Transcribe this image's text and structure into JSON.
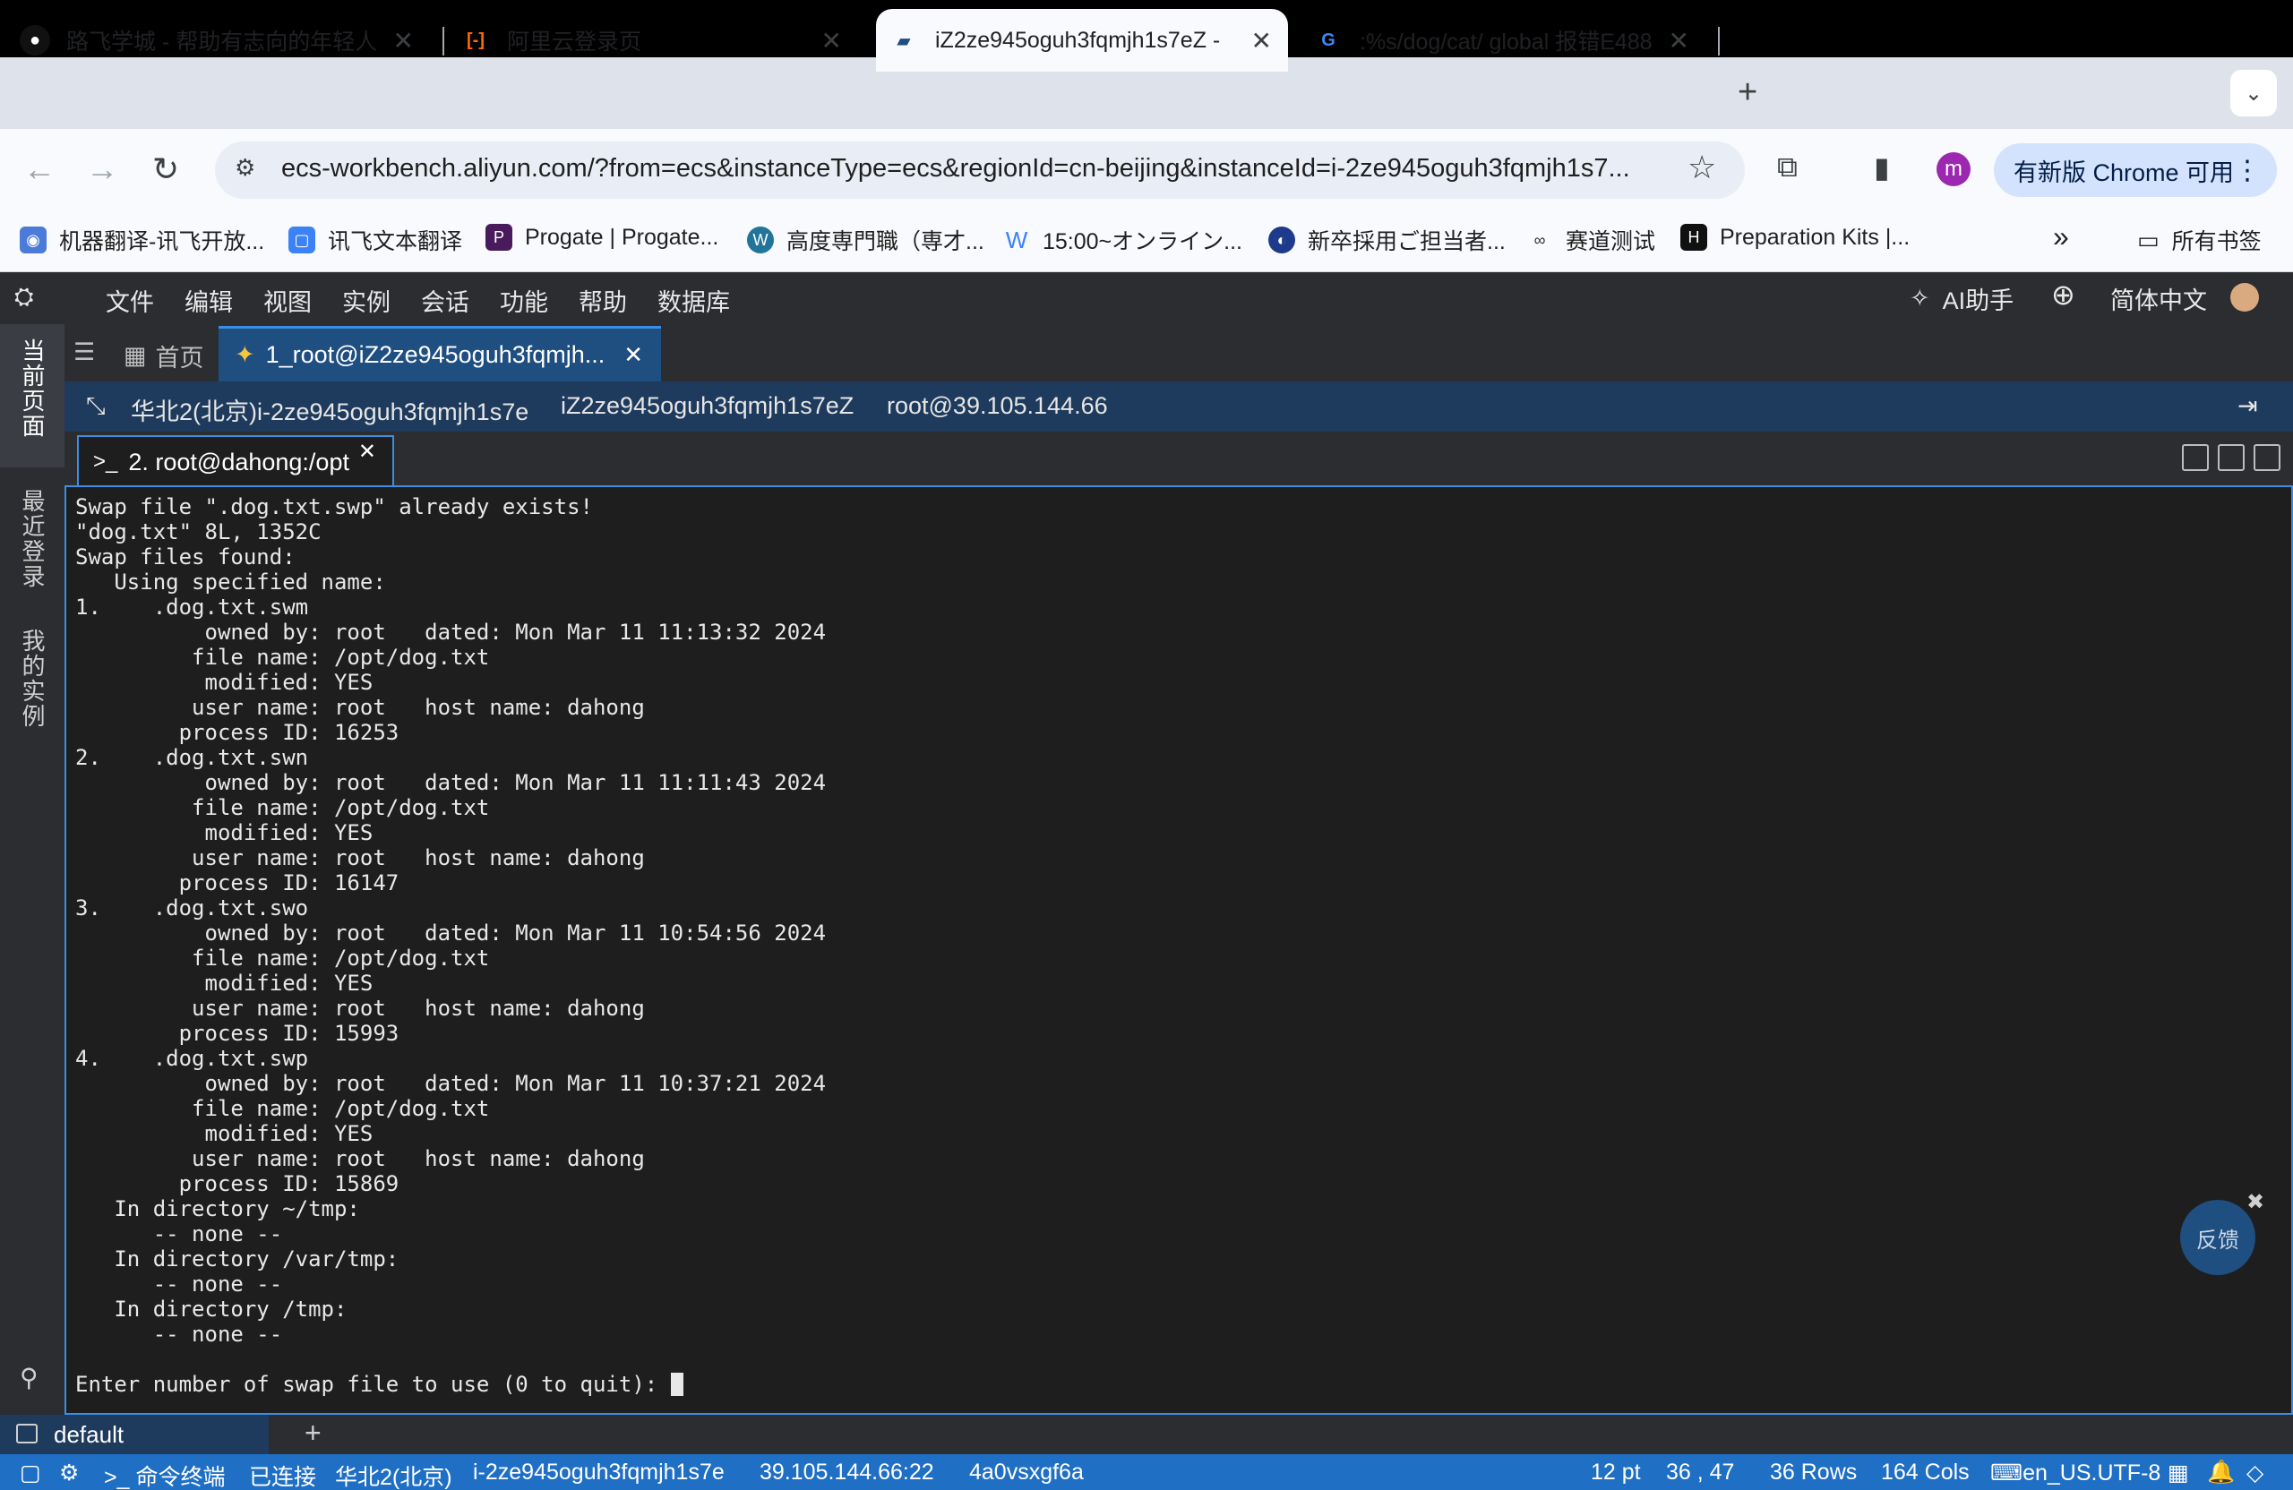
{
  "browser": {
    "tabs": [
      {
        "title": "路飞学城 - 帮助有志向的年轻人",
        "close": "✕"
      },
      {
        "title": "阿里云登录页",
        "close": "✕"
      },
      {
        "title": "iZ2ze945oguh3fqmjh1s7eZ -",
        "close": "✕"
      },
      {
        "title": ":%s/dog/cat/ global 报错E488",
        "close": "✕"
      }
    ],
    "new_tab": "+",
    "url": "ecs-workbench.aliyun.com/?from=ecs&instanceType=ecs&regionId=cn-beijing&instanceId=i-2ze945oguh3fqmjh1s7...",
    "profile_initial": "m",
    "update_button": "有新版 Chrome 可用",
    "bookmarks": [
      "机器翻译-讯飞开放...",
      "讯飞文本翻译",
      "Progate | Progate...",
      "高度専門職（専才...",
      "15:00~オンライン...",
      "新卒採用ご担当者...",
      "赛道测试",
      "Preparation Kits |..."
    ],
    "bookmarks_overflow": "»",
    "all_bookmarks": "所有书签"
  },
  "workbench": {
    "menu": [
      "文件",
      "编辑",
      "视图",
      "实例",
      "会话",
      "功能",
      "帮助",
      "数据库"
    ],
    "ai_assistant": "AI助手",
    "language": "简体中文",
    "rail": {
      "current_page": "当前页面",
      "recent_login": "最近登录",
      "my_instances": "我的实例"
    },
    "home_tab": "首页",
    "active_tab": "1_root@iZ2ze945oguh3fqmjh...",
    "info": {
      "region_instance": "华北2(北京)i-2ze945oguh3fqmjh1s7e",
      "hostname": "iZ2ze945oguh3fqmjh1s7eZ",
      "login": "root@39.105.144.66"
    },
    "terminal_tab": "2. root@dahong:/opt",
    "feedback": "反馈",
    "session": "default"
  },
  "terminal": {
    "lines": [
      "Swap file \".dog.txt.swp\" already exists!",
      "\"dog.txt\" 8L, 1352C",
      "Swap files found:",
      "   Using specified name:",
      "1.    .dog.txt.swm",
      "          owned by: root   dated: Mon Mar 11 11:13:32 2024",
      "         file name: /opt/dog.txt",
      "          modified: YES",
      "         user name: root   host name: dahong",
      "        process ID: 16253",
      "2.    .dog.txt.swn",
      "          owned by: root   dated: Mon Mar 11 11:11:43 2024",
      "         file name: /opt/dog.txt",
      "          modified: YES",
      "         user name: root   host name: dahong",
      "        process ID: 16147",
      "3.    .dog.txt.swo",
      "          owned by: root   dated: Mon Mar 11 10:54:56 2024",
      "         file name: /opt/dog.txt",
      "          modified: YES",
      "         user name: root   host name: dahong",
      "        process ID: 15993",
      "4.    .dog.txt.swp",
      "          owned by: root   dated: Mon Mar 11 10:37:21 2024",
      "         file name: /opt/dog.txt",
      "          modified: YES",
      "         user name: root   host name: dahong",
      "        process ID: 15869",
      "   In directory ~/tmp:",
      "      -- none --",
      "   In directory /var/tmp:",
      "      -- none --",
      "   In directory /tmp:",
      "      -- none --",
      "",
      "Enter number of swap file to use (0 to quit): "
    ]
  },
  "status": {
    "terminal_label": "命令终端",
    "connection": "已连接",
    "region": "华北2(北京)",
    "instance_id": "i-2ze945oguh3fqmjh1s7e",
    "address": "39.105.144.66:22",
    "session_code": "4a0vsxgf6a",
    "font_size": "12 pt",
    "cursor_pos": "36 , 47",
    "rows": "36 Rows",
    "cols": "164 Cols",
    "locale": "en_US.UTF-8"
  }
}
